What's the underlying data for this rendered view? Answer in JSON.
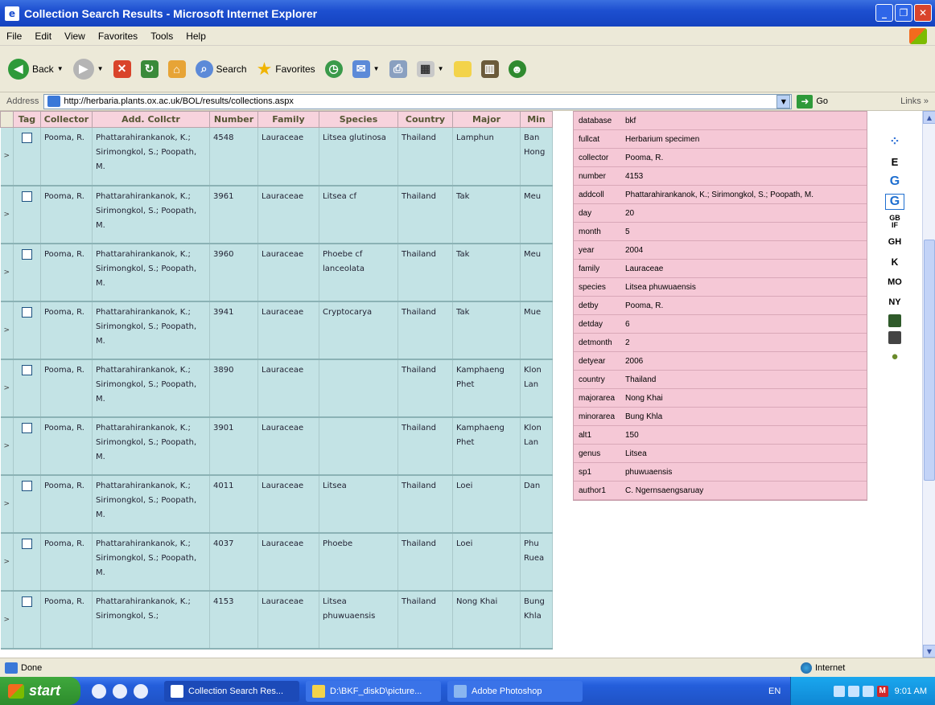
{
  "window": {
    "title": "Collection Search Results - Microsoft Internet Explorer"
  },
  "menu": [
    "File",
    "Edit",
    "View",
    "Favorites",
    "Tools",
    "Help"
  ],
  "toolbar": {
    "back_label": "Back",
    "search_label": "Search",
    "favorites_label": "Favorites"
  },
  "address": {
    "label": "Address",
    "url": "http://herbaria.plants.ox.ac.uk/BOL/results/collections.aspx",
    "go_label": "Go",
    "links_label": "Links"
  },
  "table": {
    "headers": [
      "Tag",
      "Collector",
      "Add. Collctr",
      "Number",
      "Family",
      "Species",
      "Country",
      "Major",
      "Min"
    ],
    "rows": [
      {
        "collector": "Pooma, R.",
        "addcoll": "Phattarahirankanok, K.; Sirimongkol, S.; Poopath, M.",
        "number": "4548",
        "family": "Lauraceae",
        "species": "Litsea glutinosa",
        "country": "Thailand",
        "major": "Lamphun",
        "minor": "Ban Hong"
      },
      {
        "collector": "Pooma, R.",
        "addcoll": "Phattarahirankanok, K.; Sirimongkol, S.; Poopath, M.",
        "number": "3961",
        "family": "Lauraceae",
        "species": "Litsea cf",
        "country": "Thailand",
        "major": "Tak",
        "minor": "Meu"
      },
      {
        "collector": "Pooma, R.",
        "addcoll": "Phattarahirankanok, K.; Sirimongkol, S.; Poopath, M.",
        "number": "3960",
        "family": "Lauraceae",
        "species": "Phoebe cf lanceolata",
        "country": "Thailand",
        "major": "Tak",
        "minor": "Meu"
      },
      {
        "collector": "Pooma, R.",
        "addcoll": "Phattarahirankanok, K.; Sirimongkol, S.; Poopath, M.",
        "number": "3941",
        "family": "Lauraceae",
        "species": "Cryptocarya",
        "country": "Thailand",
        "major": "Tak",
        "minor": "Mue"
      },
      {
        "collector": "Pooma, R.",
        "addcoll": "Phattarahirankanok, K.; Sirimongkol, S.; Poopath, M.",
        "number": "3890",
        "family": "Lauraceae",
        "species": "",
        "country": "Thailand",
        "major": "Kamphaeng Phet",
        "minor": "Klon Lan"
      },
      {
        "collector": "Pooma, R.",
        "addcoll": "Phattarahirankanok, K.; Sirimongkol, S.; Poopath, M.",
        "number": "3901",
        "family": "Lauraceae",
        "species": "",
        "country": "Thailand",
        "major": "Kamphaeng Phet",
        "minor": "Klon Lan"
      },
      {
        "collector": "Pooma, R.",
        "addcoll": "Phattarahirankanok, K.; Sirimongkol, S.; Poopath, M.",
        "number": "4011",
        "family": "Lauraceae",
        "species": "Litsea",
        "country": "Thailand",
        "major": "Loei",
        "minor": "Dan"
      },
      {
        "collector": "Pooma, R.",
        "addcoll": "Phattarahirankanok, K.; Sirimongkol, S.; Poopath, M.",
        "number": "4037",
        "family": "Lauraceae",
        "species": "Phoebe",
        "country": "Thailand",
        "major": "Loei",
        "minor": "Phu Ruea"
      },
      {
        "collector": "Pooma, R.",
        "addcoll": "Phattarahirankanok, K.; Sirimongkol, S.;",
        "number": "4153",
        "family": "Lauraceae",
        "species": "Litsea phuwuaensis",
        "country": "Thailand",
        "major": "Nong Khai",
        "minor": "Bung Khla"
      }
    ]
  },
  "detail": [
    {
      "k": "database",
      "v": "bkf"
    },
    {
      "k": "fullcat",
      "v": "Herbarium specimen"
    },
    {
      "k": "collector",
      "v": "Pooma, R."
    },
    {
      "k": "number",
      "v": "4153"
    },
    {
      "k": "addcoll",
      "v": "Phattarahirankanok, K.; Sirimongkol, S.; Poopath, M."
    },
    {
      "k": "day",
      "v": "20"
    },
    {
      "k": "month",
      "v": "5"
    },
    {
      "k": "year",
      "v": "2004"
    },
    {
      "k": "family",
      "v": "Lauraceae"
    },
    {
      "k": "species",
      "v": "Litsea phuwuaensis"
    },
    {
      "k": "detby",
      "v": "Pooma, R."
    },
    {
      "k": "detday",
      "v": "6"
    },
    {
      "k": "detmonth",
      "v": "2"
    },
    {
      "k": "detyear",
      "v": "2006"
    },
    {
      "k": "country",
      "v": "Thailand"
    },
    {
      "k": "majorarea",
      "v": "Nong Khai"
    },
    {
      "k": "minorarea",
      "v": "Bung Khla"
    },
    {
      "k": "alt1",
      "v": "150"
    },
    {
      "k": "genus",
      "v": "Litsea"
    },
    {
      "k": "sp1",
      "v": "phuwuaensis"
    },
    {
      "k": "author1",
      "v": "C. Ngernsaengsaruay"
    }
  ],
  "sideicons": [
    "E",
    "G",
    "G",
    "GB IF",
    "GH",
    "K",
    "MO",
    "NY"
  ],
  "status": {
    "text": "Done",
    "zone": "Internet"
  },
  "taskbar": {
    "start": "start",
    "tasks": [
      "Collection Search Res...",
      "D:\\BKF_diskD\\picture...",
      "Adobe Photoshop"
    ],
    "lang": "EN",
    "clock": "9:01 AM"
  }
}
